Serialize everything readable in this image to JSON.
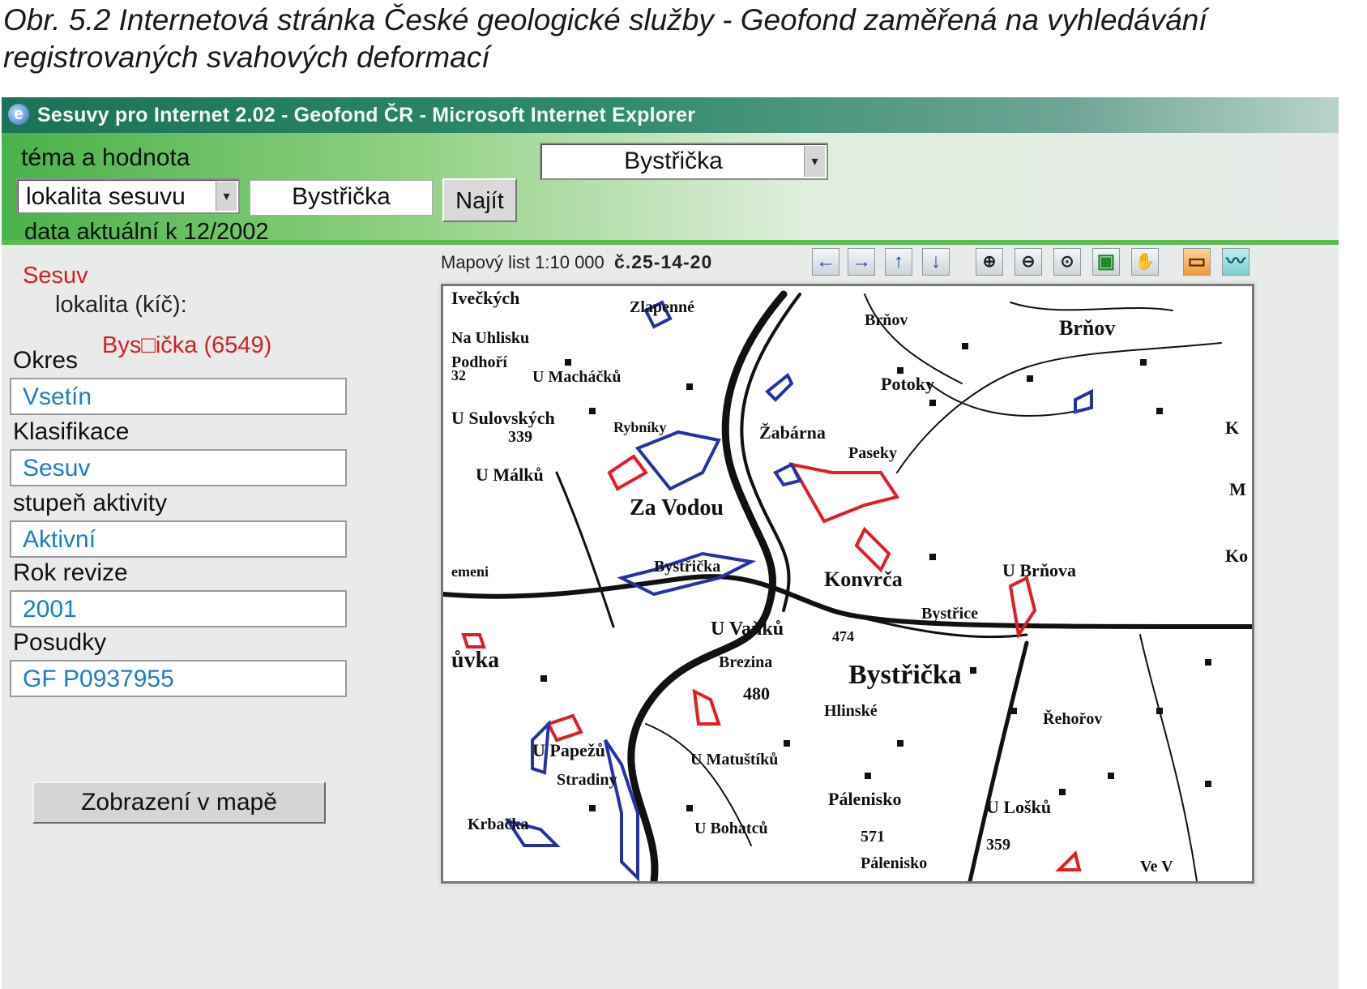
{
  "caption": {
    "line1": "Obr. 5.2  Internetová stránka České geologické služby - Geofond zaměřená na vyhledávání",
    "line2": "registrovaných svahových deformací"
  },
  "window": {
    "title": "Sesuvy pro Internet 2.02 - Geofond ČR - Microsoft Internet Explorer",
    "icon": "ie-icon"
  },
  "search": {
    "theme_label": "téma a hodnota",
    "theme_select": "lokalita sesuvu",
    "value": "Bystřička",
    "find_button": "Najít",
    "data_note": "data aktuální k 12/2002",
    "result_select": "Bystřička"
  },
  "detail": {
    "heading": "Sesuv",
    "locality_label": "lokalita (kíč):",
    "locality_value": "Bys□ička (6549)",
    "fields": [
      {
        "label": "Okres",
        "value": "Vsetín"
      },
      {
        "label": "Klasifikace",
        "value": "Sesuv"
      },
      {
        "label": "stupeň aktivity",
        "value": "Aktivní"
      },
      {
        "label": "Rok revize",
        "value": "2001"
      },
      {
        "label": "Posudky",
        "value": "GF P0937955"
      }
    ],
    "map_button": "Zobrazení v mapě"
  },
  "map": {
    "sheet_label": "Mapový list 1:10 000",
    "sheet_number": "č.25-14-20",
    "tools": [
      "arrow-left-icon",
      "arrow-right-icon",
      "arrow-up-icon",
      "arrow-down-icon",
      "zoom-in-icon",
      "zoom-out-icon",
      "zoom-point-icon",
      "zoom-extent-icon",
      "pan-hand-icon",
      "print-icon",
      "profile-icon"
    ],
    "place_labels": [
      "Ivečkých",
      "Zlapenné",
      "Brňov",
      "Brňov",
      "Na Uhlisku",
      "Podhoří",
      "32",
      "U Macháčků",
      "Potoky",
      "U Sulovských",
      "Rybníky",
      "Žabárna",
      "Paseky",
      "339",
      "K",
      "U Málků",
      "M",
      "Za Vodou",
      "Ko",
      "Bystřička",
      "emeni",
      "Konvrča",
      "U Brňova",
      "Bystřice",
      "U Vaňků",
      "474",
      "ůvka",
      "Brezina",
      "Bystřička",
      "480",
      "Hlinské",
      "Řehořov",
      "U Papežů",
      "U Matuštíků",
      "Stradiny",
      "Pálenisko",
      "U Lošků",
      "Krbačka",
      "U Bohatců",
      "571",
      "359",
      "Pálenisko",
      "Ve V"
    ]
  }
}
